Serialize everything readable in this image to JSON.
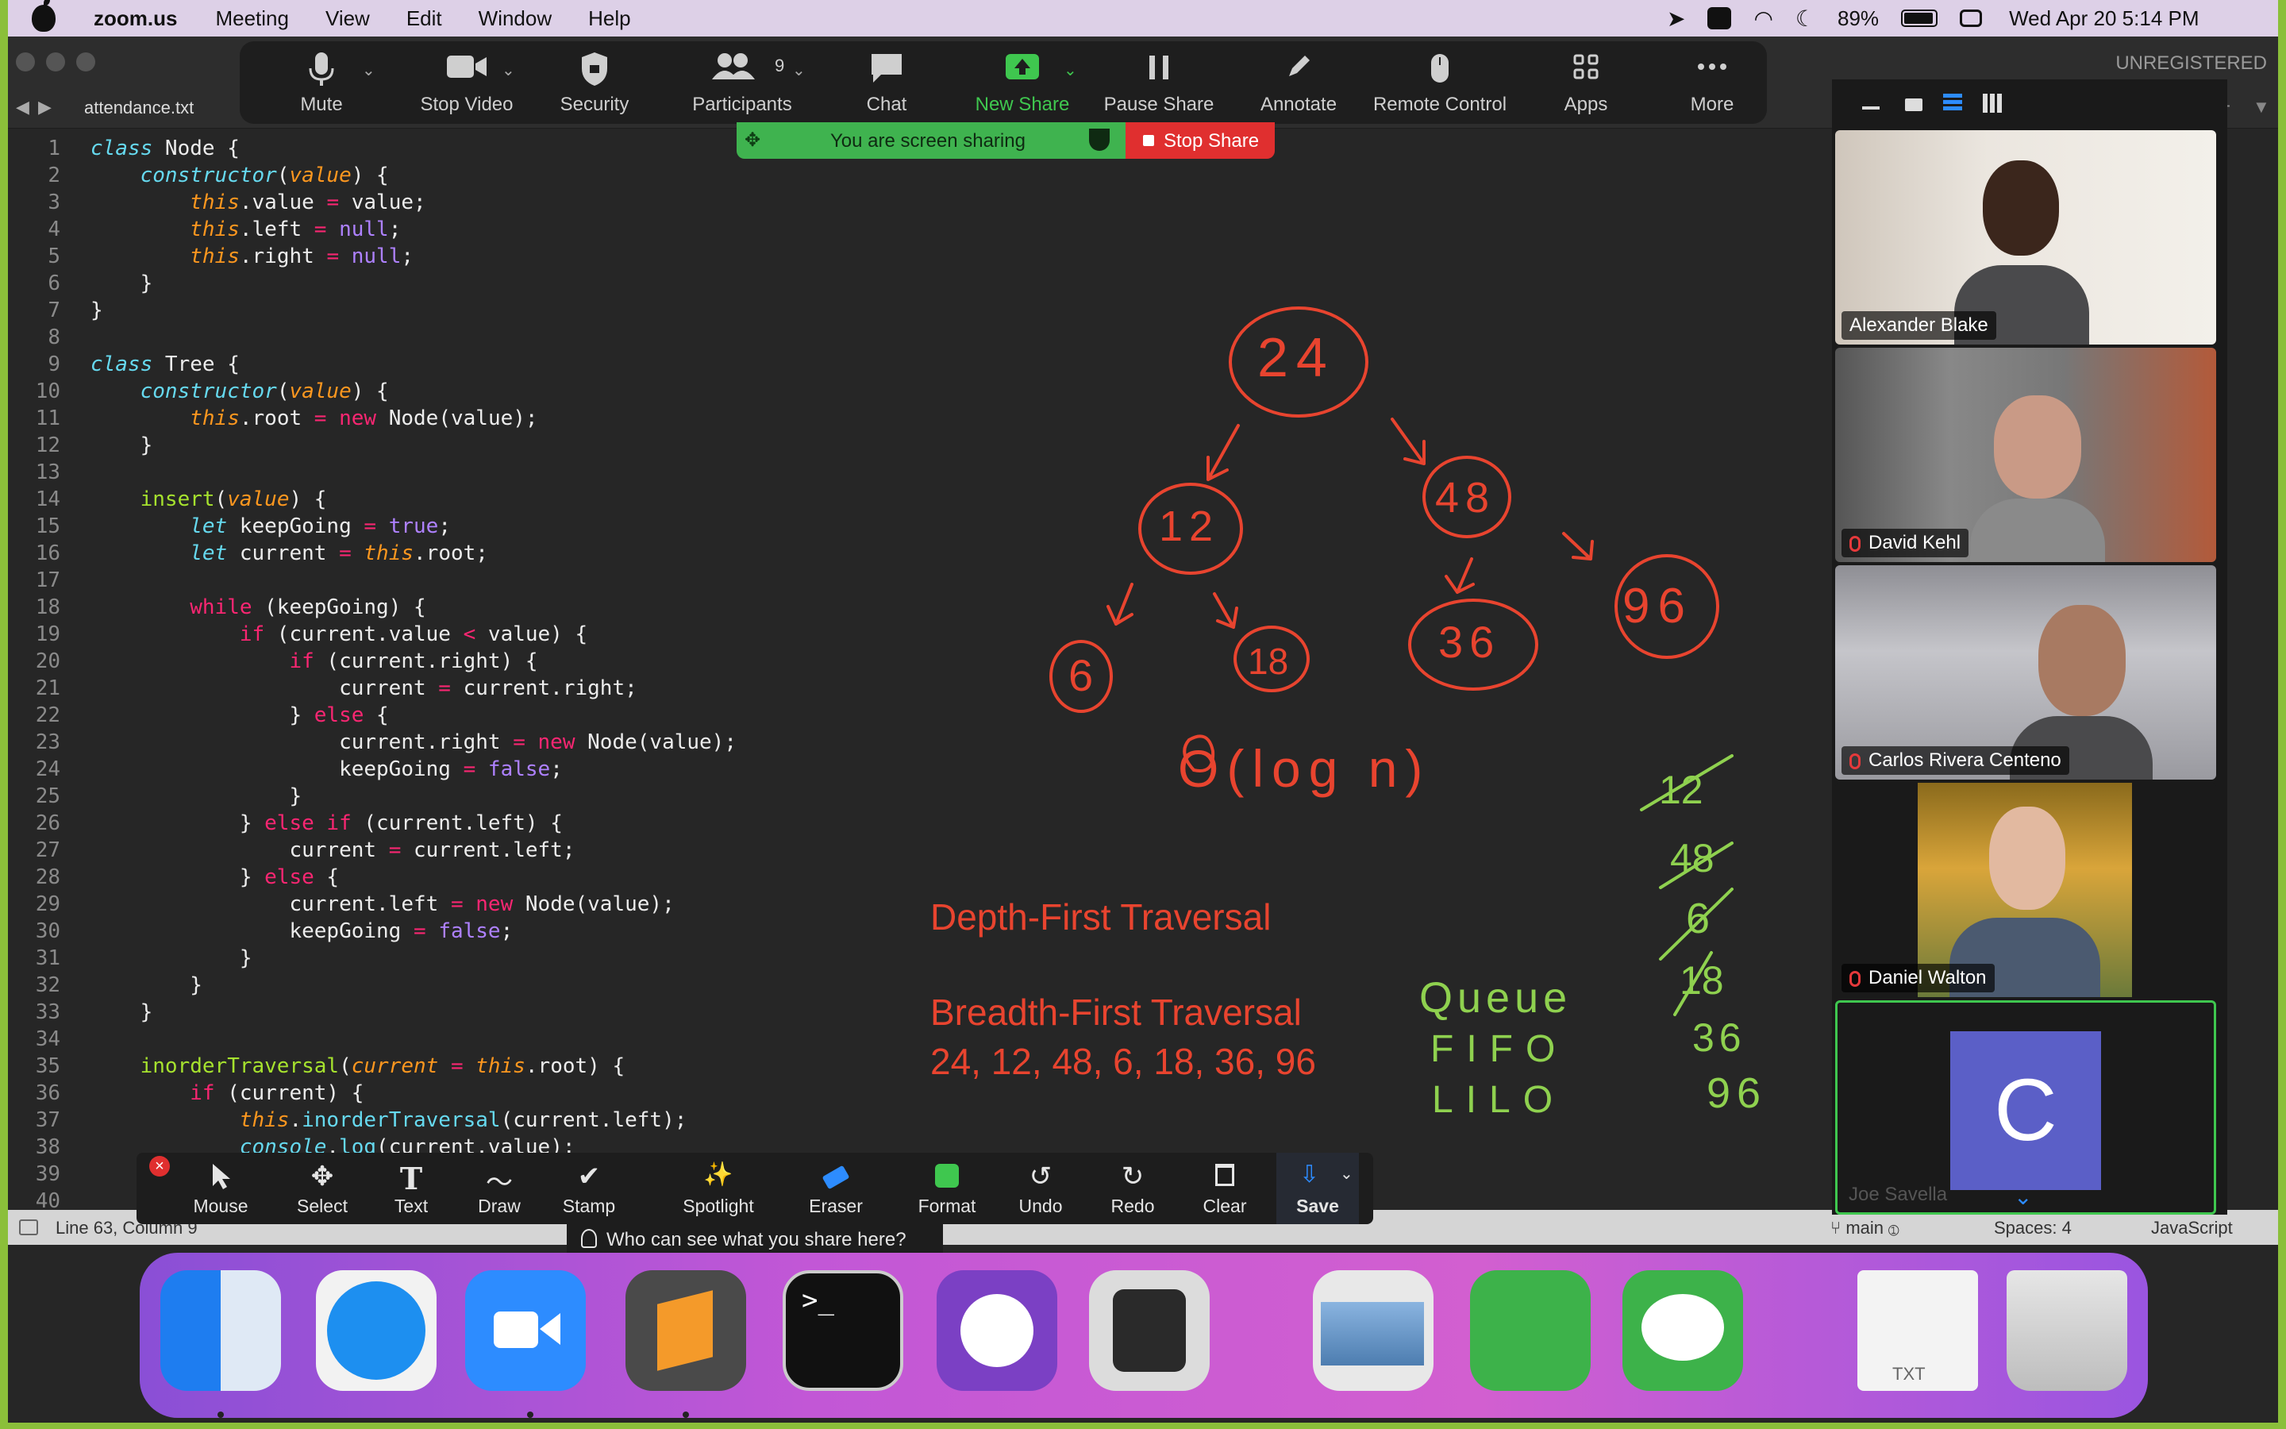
{
  "menubar": {
    "app": "zoom.us",
    "items": [
      "Meeting",
      "View",
      "Edit",
      "Window",
      "Help"
    ],
    "battery": "89%",
    "datetime": "Wed Apr 20  5:14 PM"
  },
  "editor": {
    "tab_title": "attendance.txt",
    "unregistered": "UNREGISTERED",
    "line_numbers": [
      "1",
      "2",
      "3",
      "4",
      "5",
      "6",
      "7",
      "8",
      "9",
      "10",
      "11",
      "12",
      "13",
      "14",
      "15",
      "16",
      "17",
      "18",
      "19",
      "20",
      "21",
      "22",
      "23",
      "24",
      "25",
      "26",
      "27",
      "28",
      "29",
      "30",
      "31",
      "32",
      "33",
      "34",
      "35",
      "36",
      "37",
      "38",
      "39",
      "40"
    ],
    "status_left": "Line 63, Column 9",
    "status_branch": "main",
    "status_spaces": "Spaces: 4",
    "status_syntax": "JavaScript"
  },
  "zoom_toolbar": {
    "mute": "Mute",
    "stop_video": "Stop Video",
    "security": "Security",
    "participants": "Participants",
    "participants_count": "9",
    "chat": "Chat",
    "new_share": "New Share",
    "pause_share": "Pause Share",
    "annotate": "Annotate",
    "remote_control": "Remote Control",
    "apps": "Apps",
    "more": "More"
  },
  "share_bar": {
    "status": "You are screen sharing",
    "stop": "Stop Share"
  },
  "annotation": {
    "mouse": "Mouse",
    "select": "Select",
    "text": "Text",
    "draw": "Draw",
    "stamp": "Stamp",
    "spotlight": "Spotlight",
    "eraser": "Eraser",
    "format": "Format",
    "undo": "Undo",
    "redo": "Redo",
    "clear": "Clear",
    "save": "Save",
    "who_can_see": "Who can see what you share here?"
  },
  "whiteboard": {
    "depth_first": "Depth-First Traversal",
    "breadth_first": "Breadth-First Traversal",
    "breadth_order": "24, 12, 48, 6, 18, 36, 96",
    "tree_nodes": [
      "24",
      "12",
      "48",
      "6",
      "18",
      "36",
      "96"
    ],
    "big_o": "O(log n)",
    "queue_words": [
      "Queue",
      "FIFO",
      "LILO"
    ],
    "queue_values": [
      "12",
      "48",
      "6",
      "18",
      "36",
      "96"
    ]
  },
  "participants": [
    {
      "name": "Alexander Blake",
      "muted": false
    },
    {
      "name": "David Kehl",
      "muted": true
    },
    {
      "name": "Carlos Rivera Centeno",
      "muted": true
    },
    {
      "name": "Daniel Walton",
      "muted": true
    },
    {
      "name": "Joe Savella",
      "muted": true,
      "initial": "C",
      "avatar_color": "#5b5fc7"
    }
  ],
  "dock": {
    "txt_label": "TXT"
  },
  "colors": {
    "annotation_red": "#e8442f",
    "annotation_green": "#8fd14f",
    "share_green": "#3fb34f",
    "stop_red": "#e02f2f",
    "zoom_blue": "#2d8cff"
  }
}
